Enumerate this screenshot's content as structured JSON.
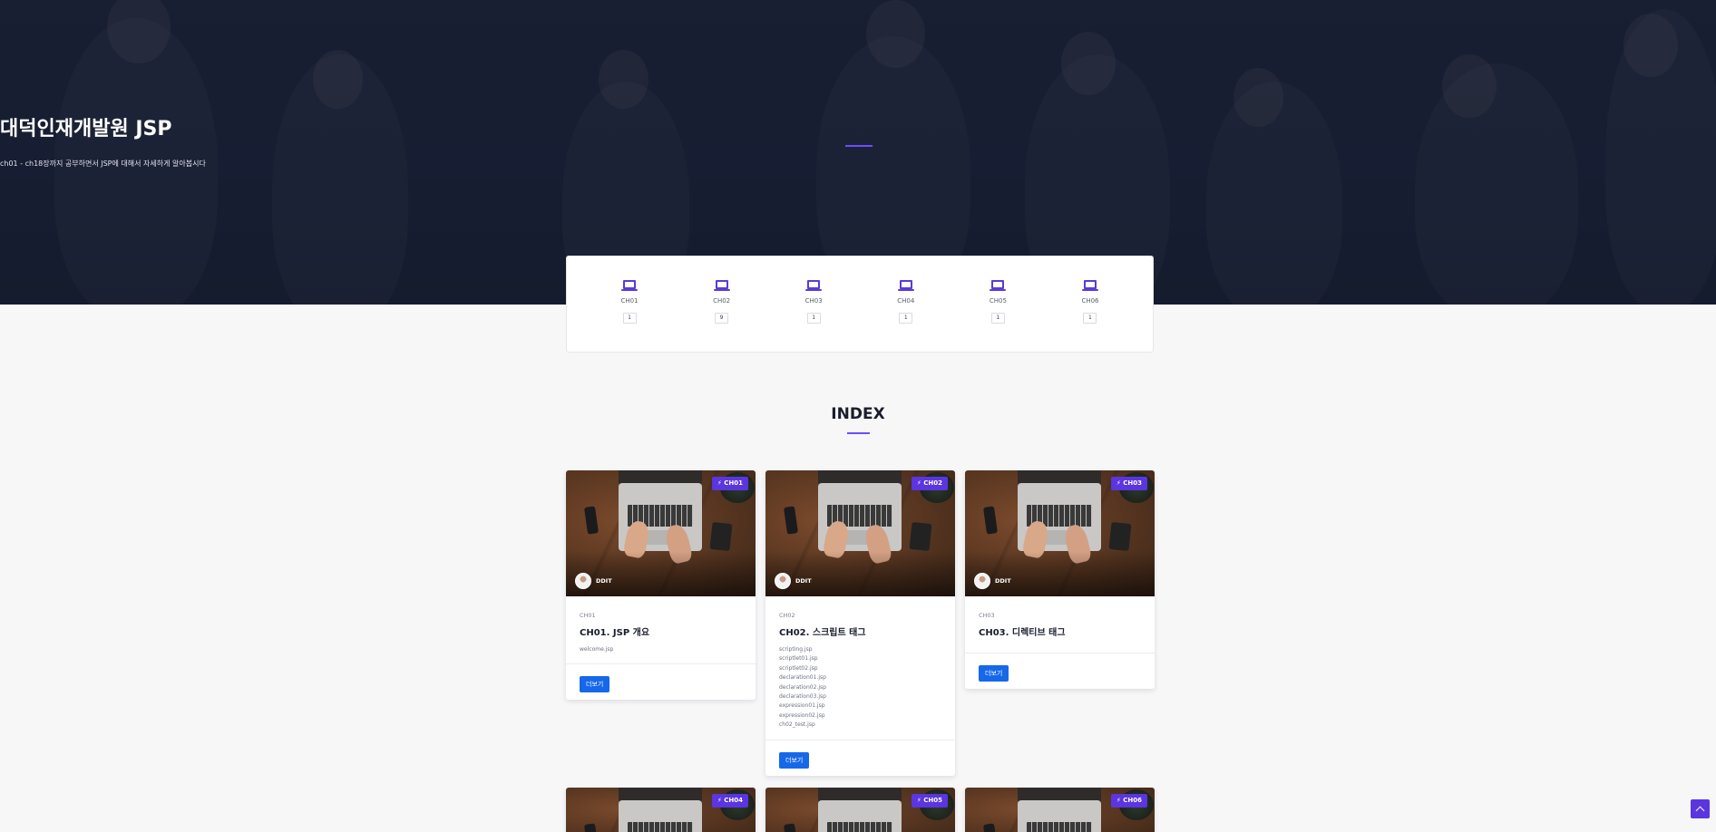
{
  "hero": {
    "title": "대덕인재개발원 JSP",
    "subtitle": "ch01 - ch18장까지 공부하면서 JSP에 대해서 자세하게 알아봅시다"
  },
  "stats": [
    {
      "label": "CH01",
      "count": "1",
      "icon": "laptop-icon"
    },
    {
      "label": "CH02",
      "count": "9",
      "icon": "laptop-icon"
    },
    {
      "label": "CH03",
      "count": "1",
      "icon": "laptop-icon"
    },
    {
      "label": "CH04",
      "count": "1",
      "icon": "laptop-icon"
    },
    {
      "label": "CH05",
      "count": "1",
      "icon": "laptop-icon"
    },
    {
      "label": "CH06",
      "count": "1",
      "icon": "laptop-icon"
    }
  ],
  "index": {
    "title": "INDEX"
  },
  "cards": [
    {
      "badge": "⚡ CH01",
      "author": "DDIT",
      "category": "CH01",
      "title": "CH01. JSP 개요",
      "files": [
        "welcome.jsp"
      ],
      "more_label": "더보기"
    },
    {
      "badge": "⚡ CH02",
      "author": "DDIT",
      "category": "CH02",
      "title": "CH02. 스크립트 태그",
      "files": [
        "scripting.jsp",
        "scriptlet01.jsp",
        "scriptlet02.jsp",
        "declaration01.jsp",
        "declaration02.jsp",
        "declaration03.jsp",
        "expression01.jsp",
        "expression02.jsp",
        "ch02_test.jsp"
      ],
      "more_label": "더보기"
    },
    {
      "badge": "⚡ CH03",
      "author": "DDIT",
      "category": "CH03",
      "title": "CH03. 디렉티브 태그",
      "files": [],
      "more_label": "더보기"
    },
    {
      "badge": "⚡ CH04"
    },
    {
      "badge": "⚡ CH05"
    },
    {
      "badge": "⚡ CH06"
    }
  ],
  "colors": {
    "accent": "#5a35e0",
    "button": "#1668e8",
    "hero_bg": "#1a2135"
  }
}
